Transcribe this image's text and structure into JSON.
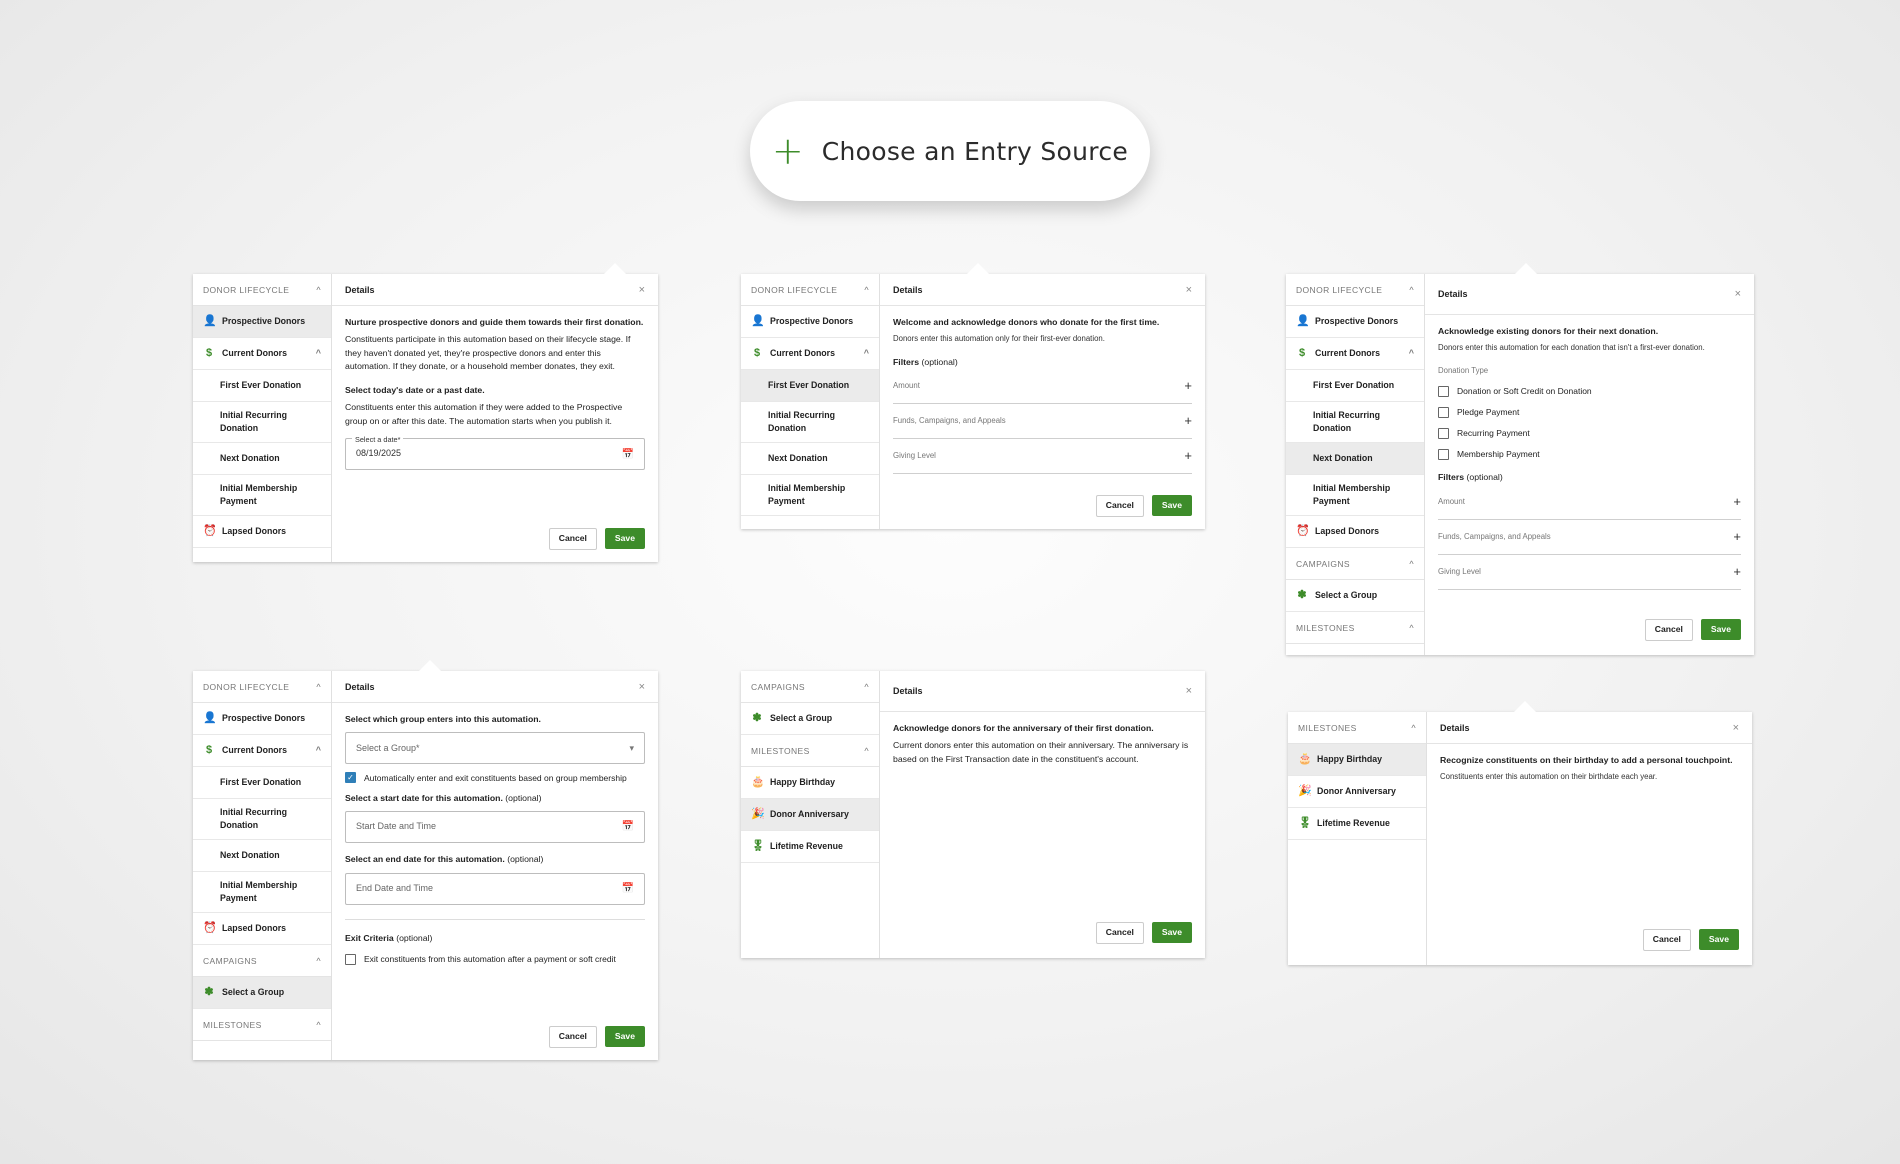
{
  "entry": {
    "plus_icon": "+",
    "label": "Choose an Entry Source"
  },
  "common": {
    "details": "Details",
    "cancel": "Cancel",
    "save": "Save",
    "close_icon": "×",
    "chevron_up": "^",
    "chevron_down": "▾",
    "calendar_icon": "📅",
    "plus_icon": "+",
    "check_icon": "✓"
  },
  "sidebar": {
    "donor_lifecycle": "DONOR LIFECYCLE",
    "prospective": "Prospective Donors",
    "current": "Current Donors",
    "first_ever": "First Ever Donation",
    "initial_recurring": "Initial Recurring Donation",
    "next_donation": "Next Donation",
    "initial_membership": "Initial Membership Payment",
    "lapsed": "Lapsed Donors",
    "campaigns": "CAMPAIGNS",
    "select_group": "Select a Group",
    "milestones": "MILESTONES",
    "happy_birthday": "Happy Birthday",
    "donor_anniversary": "Donor Anniversary",
    "lifetime_revenue": "Lifetime Revenue"
  },
  "panel1": {
    "heading": "Nurture prospective donors and guide them towards their first donation.",
    "desc": "Constituents participate in this automation based on their lifecycle stage. If they haven't donated yet, they're prospective donors and enter this automation. If they donate, or a household member donates, they exit.",
    "date_heading": "Select today's date or a past date.",
    "date_desc": "Constituents enter this automation if they were added to the Prospective group on or after this date. The automation starts when you publish it.",
    "date_label": "Select a date*",
    "date_value": "08/19/2025"
  },
  "panel2": {
    "heading": "Welcome and acknowledge donors who donate for the first time.",
    "desc": "Donors enter this automation only for their first-ever donation.",
    "filters": "Filters",
    "optional": "(optional)",
    "amount": "Amount",
    "funds": "Funds, Campaigns, and Appeals",
    "giving_level": "Giving Level"
  },
  "panel3": {
    "heading": "Acknowledge existing donors for their next donation.",
    "desc": "Donors enter this automation for each donation that isn't a first-ever donation.",
    "donation_type": "Donation Type",
    "options": [
      "Donation or Soft Credit on Donation",
      "Pledge Payment",
      "Recurring Payment",
      "Membership Payment"
    ]
  },
  "panel4": {
    "group_heading": "Select which group enters into this automation.",
    "group_placeholder": "Select a Group*",
    "auto_enter": "Automatically enter and exit constituents based on group membership",
    "start_heading": "Select a start date for this automation.",
    "start_placeholder": "Start Date and Time",
    "end_heading": "Select an end date for this automation.",
    "end_placeholder": "End Date and Time",
    "exit_criteria": "Exit Criteria",
    "exit_option": "Exit constituents from this automation after a payment or soft credit"
  },
  "panel5": {
    "heading": "Acknowledge donors for the anniversary of their first donation.",
    "desc": "Current donors enter this automation on their anniversary. The anniversary is based on the First Transaction date in the constituent's account."
  },
  "panel6": {
    "heading": "Recognize constituents on their birthday to add a personal touchpoint.",
    "desc": "Constituents enter this automation on their birthdate each year."
  },
  "icons": {
    "prospective": "person-add-icon",
    "current": "dollar-circle-icon",
    "lapsed": "alarm-clock-icon",
    "select_group": "group-icon",
    "happy_birthday": "cake-icon",
    "donor_anniversary": "party-popper-icon",
    "lifetime_revenue": "award-ribbon-icon"
  },
  "colors": {
    "accent": "#3d8c2a",
    "checkbox": "#2f7fb8"
  }
}
